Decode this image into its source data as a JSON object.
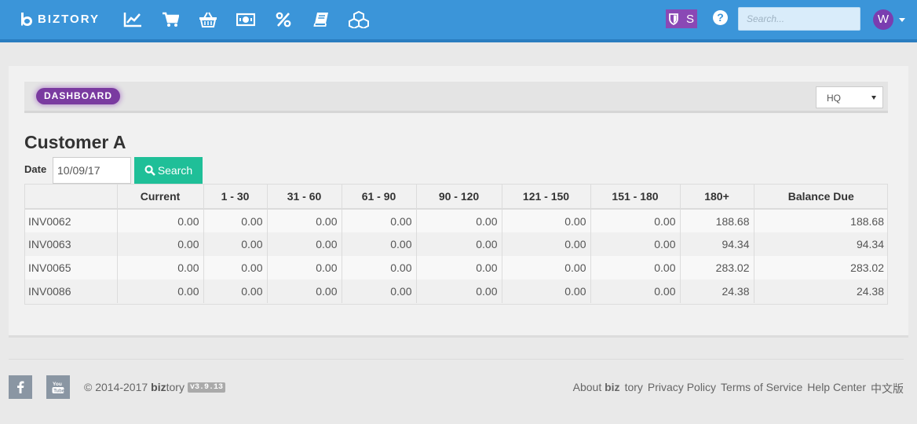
{
  "header": {
    "brand": "BIZTORY",
    "nav_icons": [
      "chart-line-icon",
      "cart-icon",
      "basket-icon",
      "money-icon",
      "percent-icon",
      "book-icon",
      "cubes-icon"
    ],
    "shield_letter": "S",
    "help_glyph": "?",
    "search_placeholder": "Search...",
    "avatar_initial": "W",
    "accent_color": "#3b95d9"
  },
  "toolbar": {
    "dashboard_label": "DASHBOARD",
    "branch_value": "HQ"
  },
  "report": {
    "customer": "Customer A",
    "date_label": "Date",
    "date_value": "10/09/17",
    "search_label": "Search",
    "columns": [
      "",
      "Current",
      "1 - 30",
      "31 - 60",
      "61 - 90",
      "90 - 120",
      "121 - 150",
      "151 - 180",
      "180+",
      "Balance Due"
    ],
    "rows": [
      [
        "INV0062",
        "0.00",
        "0.00",
        "0.00",
        "0.00",
        "0.00",
        "0.00",
        "0.00",
        "188.68",
        "188.68"
      ],
      [
        "INV0063",
        "0.00",
        "0.00",
        "0.00",
        "0.00",
        "0.00",
        "0.00",
        "0.00",
        "94.34",
        "94.34"
      ],
      [
        "INV0065",
        "0.00",
        "0.00",
        "0.00",
        "0.00",
        "0.00",
        "0.00",
        "0.00",
        "283.02",
        "283.02"
      ],
      [
        "INV0086",
        "0.00",
        "0.00",
        "0.00",
        "0.00",
        "0.00",
        "0.00",
        "0.00",
        "24.38",
        "24.38"
      ]
    ]
  },
  "footer": {
    "copyright_prefix": "© 2014-2017",
    "brand_bold": "biz",
    "brand_rest": "tory",
    "version": "v3.9.13",
    "about_prefix": "About",
    "about_bold": "biz",
    "about_rest": "tory",
    "links": [
      "Privacy Policy",
      "Terms of Service",
      "Help Center",
      "中文版"
    ]
  }
}
